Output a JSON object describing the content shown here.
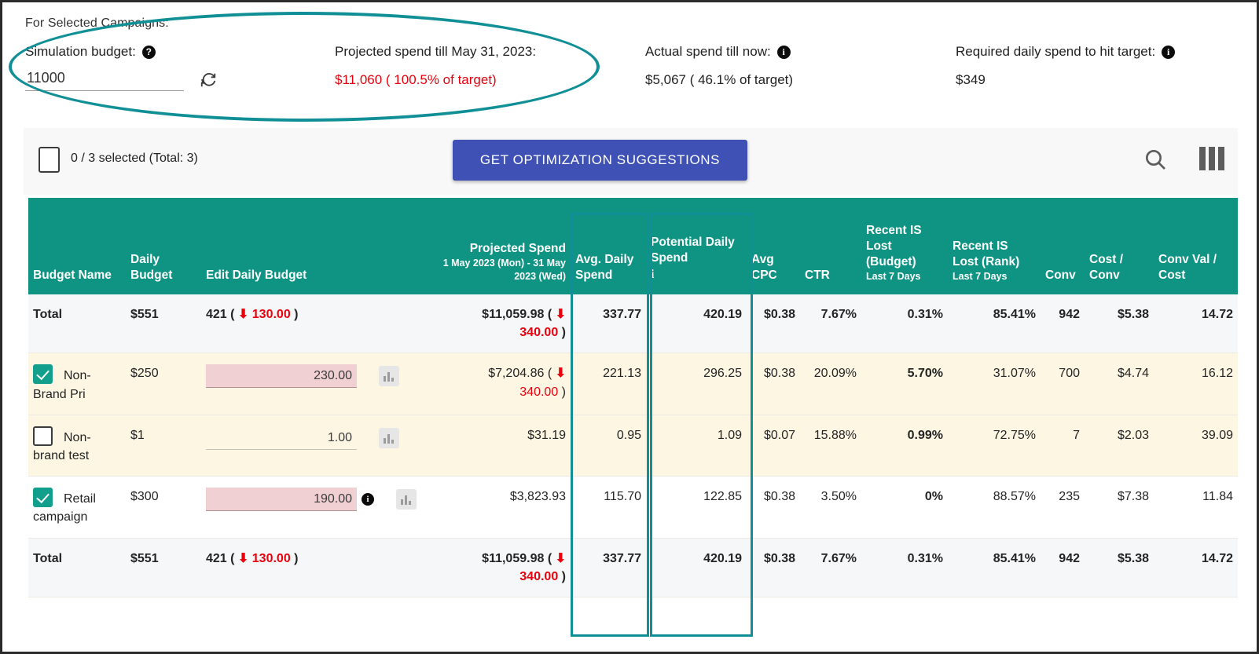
{
  "summary": {
    "caption": "For Selected Campaigns:",
    "columns": [
      {
        "label": "Simulation budget:",
        "icon": "help-circle-icon",
        "input_value": "11000",
        "input_placeholder": "",
        "refresh_icon": "refresh-icon"
      },
      {
        "label": "Projected spend till May 31, 2023:",
        "value": "$11,060 ( 100.5% of target)",
        "value_color": "#e8000d"
      },
      {
        "label": "Actual spend till now:",
        "icon": "info-circle-icon",
        "value": "$5,067 ( 46.1% of target)"
      },
      {
        "label": "Required daily spend to hit target:",
        "icon": "info-circle-icon",
        "value": "$349"
      }
    ]
  },
  "toolbar": {
    "select_count": "0 / 3 selected (Total: 3)",
    "optimize_label": "GET OPTIMIZATION SUGGESTIONS",
    "search_icon": "search-icon",
    "columns_icon": "columns-icon"
  },
  "table": {
    "headers": [
      {
        "title": "Budget Name",
        "sub": ""
      },
      {
        "title": "Daily Budget",
        "sub": ""
      },
      {
        "title": "Edit Daily Budget",
        "sub": ""
      },
      {
        "title": "Projected Spend",
        "sub": "1 May 2023 (Mon) - 31 May 2023 (Wed)"
      },
      {
        "title": "Avg. Daily Spend",
        "sub": ""
      },
      {
        "title": "Potential Daily Spend",
        "sub": ""
      },
      {
        "title": "Avg CPC",
        "sub": ""
      },
      {
        "title": "CTR",
        "sub": ""
      },
      {
        "title": "Recent IS Lost (Budget)",
        "sub": "Last 7 Days"
      },
      {
        "title": "Recent IS Lost (Rank)",
        "sub": "Last 7 Days"
      },
      {
        "title": "Conv",
        "sub": ""
      },
      {
        "title": "Cost / Conv",
        "sub": ""
      },
      {
        "title": "Conv Val / Cost",
        "sub": ""
      }
    ],
    "rows": [
      {
        "type": "total",
        "name": "Total",
        "checkbox": "none",
        "daily_budget": "$551",
        "edit_budget_text": "421",
        "edit_delta": "130.00",
        "edit_has_field": false,
        "projected_spend": "$11,059.98",
        "projected_delta": "340.00",
        "avg_daily_spend": "337.77",
        "potential_daily_spend": "420.19",
        "avg_cpc": "$0.38",
        "ctr": "7.67%",
        "is_lost_budget": "0.31%",
        "is_lost_rank": "85.41%",
        "conv": "942",
        "cost_per_conv": "$5.38",
        "conv_val_cost": "14.72"
      },
      {
        "type": "alt",
        "name": "Non-Brand Pri",
        "checkbox": "checked",
        "daily_budget": "$250",
        "edit_value": "230.00",
        "edit_dirty": true,
        "edit_info": false,
        "projected_spend": "$7,204.86",
        "projected_delta": "340.00",
        "avg_daily_spend": "221.13",
        "potential_daily_spend": "296.25",
        "avg_cpc": "$0.38",
        "ctr": "20.09%",
        "is_lost_budget": "5.70%",
        "is_lost_rank": "31.07%",
        "conv": "700",
        "cost_per_conv": "$4.74",
        "conv_val_cost": "16.12"
      },
      {
        "type": "alt",
        "name": "Non-brand test",
        "checkbox": "unchecked",
        "daily_budget": "$1",
        "edit_value": "1.00",
        "edit_dirty": false,
        "edit_info": false,
        "projected_spend": "$31.19",
        "projected_delta": "",
        "avg_daily_spend": "0.95",
        "potential_daily_spend": "1.09",
        "avg_cpc": "$0.07",
        "ctr": "15.88%",
        "is_lost_budget": "0.99%",
        "is_lost_rank": "72.75%",
        "conv": "7",
        "cost_per_conv": "$2.03",
        "conv_val_cost": "39.09"
      },
      {
        "type": "plain",
        "name": "Retail campaign",
        "checkbox": "checked",
        "daily_budget": "$300",
        "edit_value": "190.00",
        "edit_dirty": true,
        "edit_info": true,
        "projected_spend": "$3,823.93",
        "projected_delta": "",
        "avg_daily_spend": "115.70",
        "potential_daily_spend": "122.85",
        "avg_cpc": "$0.38",
        "ctr": "3.50%",
        "is_lost_budget": "0%",
        "is_lost_rank": "88.57%",
        "conv": "235",
        "cost_per_conv": "$7.38",
        "conv_val_cost": "11.84"
      },
      {
        "type": "total",
        "name": "Total",
        "checkbox": "none",
        "daily_budget": "$551",
        "edit_budget_text": "421",
        "edit_delta": "130.00",
        "edit_has_field": false,
        "projected_spend": "$11,059.98",
        "projected_delta": "340.00",
        "avg_daily_spend": "337.77",
        "potential_daily_spend": "420.19",
        "avg_cpc": "$0.38",
        "ctr": "7.67%",
        "is_lost_budget": "0.31%",
        "is_lost_rank": "85.41%",
        "conv": "942",
        "cost_per_conv": "$5.38",
        "conv_val_cost": "14.72"
      }
    ]
  },
  "annotations": {
    "ellipse_color": "#108f96",
    "highlight_columns": [
      "Avg. Daily Spend",
      "Potential Daily Spend"
    ],
    "highlight_color": "#108f96"
  }
}
